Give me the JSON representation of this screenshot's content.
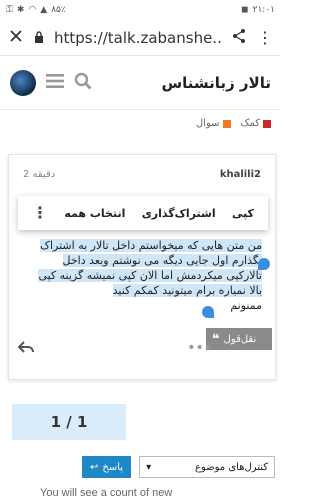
{
  "statusbar": {
    "time": "۲۱:۰۱",
    "battery": "۸۵٪"
  },
  "urlbar": {
    "url": "https://talk.zabanshe..."
  },
  "header": {
    "title": "تالار زبانشناس"
  },
  "categories": [
    {
      "label": "کمک",
      "color": "#c62828"
    },
    {
      "label": "سوال",
      "color": "#f07a20"
    }
  ],
  "post": {
    "username": "khalili2",
    "time": "2 دقیقه",
    "body_highlighted": "من متن هایی که میخواستم داخل تالار به اشتراک بگذارم اول جایی دیگه می نوشتم وبعد داخل تالارکپی میکردمش اما الان کپی نمیشه گزینه کپی بالا نمیاره برام میتونید کمکم کنید",
    "body_rest": "ممنونم"
  },
  "selection_menu": {
    "copy": "کپی",
    "share": "اشتراک‌گذاری",
    "select_all": "انتخاب همه"
  },
  "quote_button": {
    "label": "نقل‌قول"
  },
  "pager": {
    "label": "1 / 1"
  },
  "bottom": {
    "reply_label": "پاسخ",
    "topic_controls_label": "کنترل‌های موضوع",
    "note": "You will see a count of new"
  }
}
